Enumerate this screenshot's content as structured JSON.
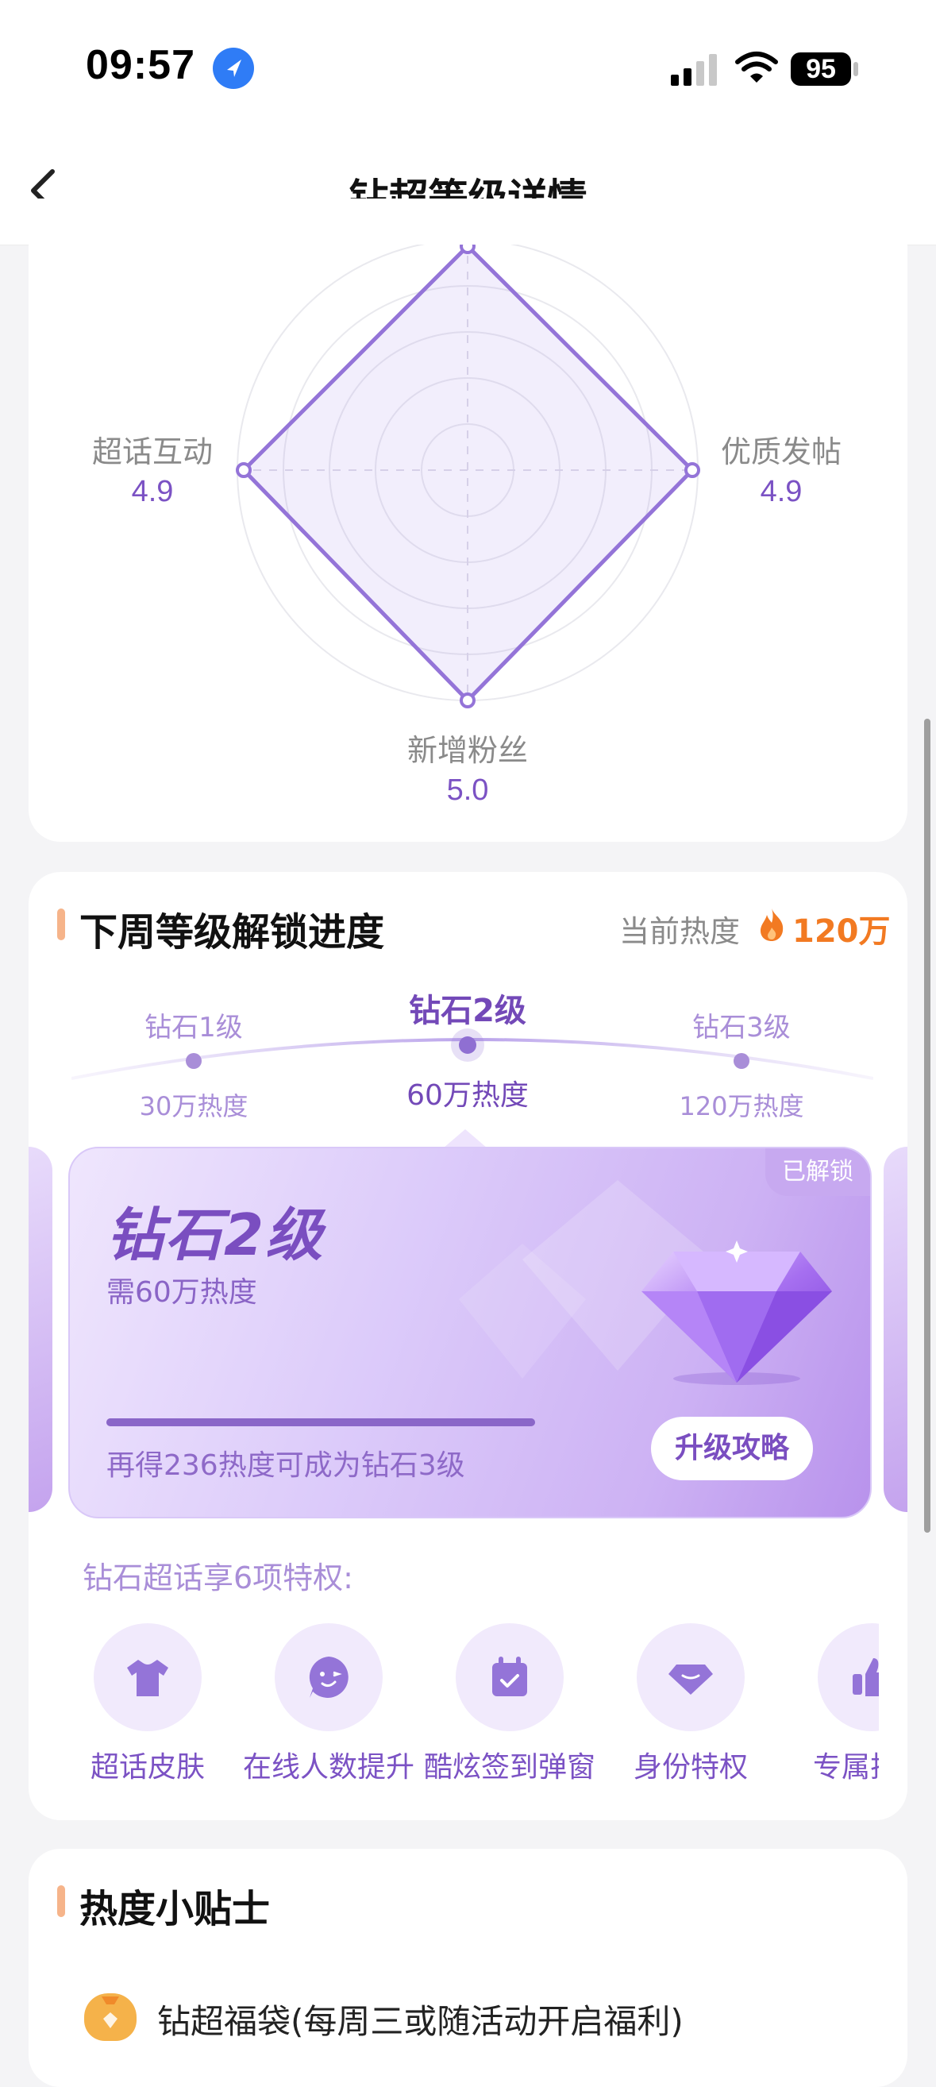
{
  "status_bar": {
    "time": "09:57",
    "battery": "95"
  },
  "nav": {
    "title": "钻超等级详情",
    "back_icon": "chevron-left-icon"
  },
  "radar": {
    "axes": [
      {
        "label": "",
        "value": ""
      },
      {
        "label": "优质发帖",
        "value": "4.9"
      },
      {
        "label": "新增粉丝",
        "value": "5.0"
      },
      {
        "label": "超话互动",
        "value": "4.9"
      }
    ],
    "accent": "#9474d8"
  },
  "progress": {
    "title": "下周等级解锁进度",
    "current_heat_label": "当前热度",
    "current_heat_value": "120万",
    "levels": [
      {
        "name": "钻石1级",
        "heat": "30万热度"
      },
      {
        "name": "钻石2级",
        "heat": "60万热度"
      },
      {
        "name": "钻石3级",
        "heat": "120万热度"
      }
    ],
    "card": {
      "badge": "已解锁",
      "level": "钻石2级",
      "need": "需60万热度",
      "hint": "再得236热度可成为钻石3级",
      "button": "升级攻略",
      "progress": 1.0
    },
    "privilege_title": "钻石超话享6项特权:",
    "privileges": [
      {
        "label": "超话皮肤",
        "icon": "tshirt-icon"
      },
      {
        "label": "在线人数提升",
        "icon": "face-icon"
      },
      {
        "label": "酷炫签到弹窗",
        "icon": "calendar-check-icon"
      },
      {
        "label": "身份特权",
        "icon": "diamond-icon"
      },
      {
        "label": "专属挂",
        "icon": "thumb-icon"
      }
    ]
  },
  "tips": {
    "title": "热度小贴士",
    "items": [
      {
        "text": "钻超福袋(每周三或随活动开启福利)",
        "icon": "lucky-bag-icon"
      }
    ]
  },
  "colors": {
    "accent": "#7b52c4",
    "heat": "#f27a22",
    "bar": "#f6b48a"
  }
}
